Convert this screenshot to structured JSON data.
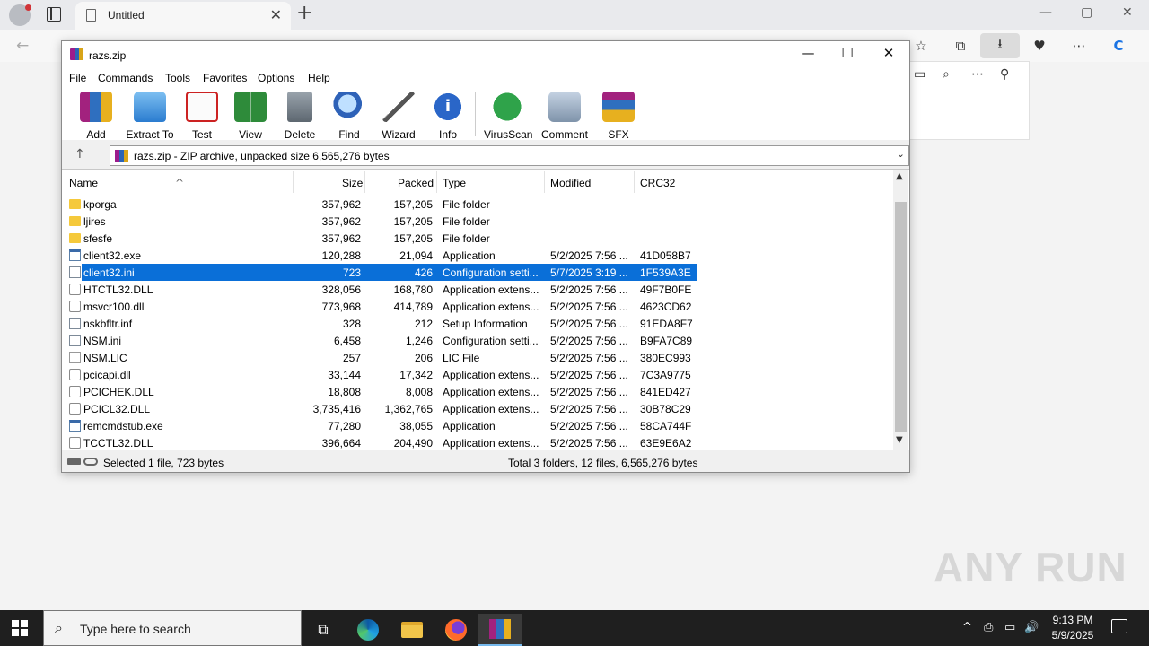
{
  "browser": {
    "tab_title": "Untitled",
    "tab_close": "✕",
    "new_tab": "+",
    "win_min": "—",
    "win_max": "▢",
    "win_close": "✕",
    "back": "←",
    "right_icons": [
      "☆",
      "⧉",
      "⭳",
      "♥",
      "⋯",
      "C"
    ],
    "panel_icons": [
      "▭",
      "⌕",
      "⋯",
      "⚲"
    ]
  },
  "winrar": {
    "title": "razs.zip",
    "title_min": "—",
    "title_max": "☐",
    "title_close": "✕",
    "menu": [
      "File",
      "Commands",
      "Tools",
      "Favorites",
      "Options",
      "Help"
    ],
    "toolbar": [
      {
        "label": "Add",
        "icon": "add-icon"
      },
      {
        "label": "Extract To",
        "icon": "extract-icon"
      },
      {
        "label": "Test",
        "icon": "test-icon"
      },
      {
        "label": "View",
        "icon": "view-icon"
      },
      {
        "label": "Delete",
        "icon": "delete-icon"
      },
      {
        "label": "Find",
        "icon": "find-icon"
      },
      {
        "label": "Wizard",
        "icon": "wizard-icon"
      },
      {
        "label": "Info",
        "icon": "info-icon"
      },
      {
        "label": "VirusScan",
        "icon": "virusscan-icon"
      },
      {
        "label": "Comment",
        "icon": "comment-icon"
      },
      {
        "label": "SFX",
        "icon": "sfx-icon"
      }
    ],
    "path": "razs.zip - ZIP archive, unpacked size 6,565,276 bytes",
    "up_arrow": "↑",
    "path_dropdown": "⌄",
    "columns": {
      "name": "Name",
      "size": "Size",
      "packed": "Packed",
      "type": "Type",
      "modified": "Modified",
      "crc": "CRC32"
    },
    "sort_indicator": "^",
    "files": [
      {
        "name": "kporga",
        "size": "357,962",
        "packed": "157,205",
        "type": "File folder",
        "modified": "",
        "crc": "",
        "kind": "folder"
      },
      {
        "name": "ljires",
        "size": "357,962",
        "packed": "157,205",
        "type": "File folder",
        "modified": "",
        "crc": "",
        "kind": "folder"
      },
      {
        "name": "sfesfe",
        "size": "357,962",
        "packed": "157,205",
        "type": "File folder",
        "modified": "",
        "crc": "",
        "kind": "folder"
      },
      {
        "name": "client32.exe",
        "size": "120,288",
        "packed": "21,094",
        "type": "Application",
        "modified": "5/2/2025 7:56 ...",
        "crc": "41D058B7",
        "kind": "exe"
      },
      {
        "name": "client32.ini",
        "size": "723",
        "packed": "426",
        "type": "Configuration setti...",
        "modified": "5/7/2025 3:19 ...",
        "crc": "1F539A3E",
        "kind": "ini",
        "selected": true
      },
      {
        "name": "HTCTL32.DLL",
        "size": "328,056",
        "packed": "168,780",
        "type": "Application extens...",
        "modified": "5/2/2025 7:56 ...",
        "crc": "49F7B0FE",
        "kind": "dll"
      },
      {
        "name": "msvcr100.dll",
        "size": "773,968",
        "packed": "414,789",
        "type": "Application extens...",
        "modified": "5/2/2025 7:56 ...",
        "crc": "4623CD62",
        "kind": "dll"
      },
      {
        "name": "nskbfltr.inf",
        "size": "328",
        "packed": "212",
        "type": "Setup Information",
        "modified": "5/2/2025 7:56 ...",
        "crc": "91EDA8F7",
        "kind": "ini"
      },
      {
        "name": "NSM.ini",
        "size": "6,458",
        "packed": "1,246",
        "type": "Configuration setti...",
        "modified": "5/2/2025 7:56 ...",
        "crc": "B9FA7C89",
        "kind": "ini"
      },
      {
        "name": "NSM.LIC",
        "size": "257",
        "packed": "206",
        "type": "LIC File",
        "modified": "5/2/2025 7:56 ...",
        "crc": "380EC993",
        "kind": "plain"
      },
      {
        "name": "pcicapi.dll",
        "size": "33,144",
        "packed": "17,342",
        "type": "Application extens...",
        "modified": "5/2/2025 7:56 ...",
        "crc": "7C3A9775",
        "kind": "dll"
      },
      {
        "name": "PCICHEK.DLL",
        "size": "18,808",
        "packed": "8,008",
        "type": "Application extens...",
        "modified": "5/2/2025 7:56 ...",
        "crc": "841ED427",
        "kind": "dll"
      },
      {
        "name": "PCICL32.DLL",
        "size": "3,735,416",
        "packed": "1,362,765",
        "type": "Application extens...",
        "modified": "5/2/2025 7:56 ...",
        "crc": "30B78C29",
        "kind": "dll"
      },
      {
        "name": "remcmdstub.exe",
        "size": "77,280",
        "packed": "38,055",
        "type": "Application",
        "modified": "5/2/2025 7:56 ...",
        "crc": "58CA744F",
        "kind": "exe"
      },
      {
        "name": "TCCTL32.DLL",
        "size": "396,664",
        "packed": "204,490",
        "type": "Application extens...",
        "modified": "5/2/2025 7:56 ...",
        "crc": "63E9E6A2",
        "kind": "dll"
      }
    ],
    "status_left": "Selected 1 file, 723 bytes",
    "status_right": "Total 3 folders, 12 files, 6,565,276 bytes"
  },
  "taskbar": {
    "search_placeholder": "Type here to search",
    "time": "9:13 PM",
    "date": "5/9/2025",
    "tray_icons": [
      "^",
      "⎙",
      "▭",
      "🔊"
    ]
  },
  "watermark": "ANY RUN",
  "colors": {
    "selection": "#0a6fd8",
    "taskbar": "#1f1f1f"
  }
}
